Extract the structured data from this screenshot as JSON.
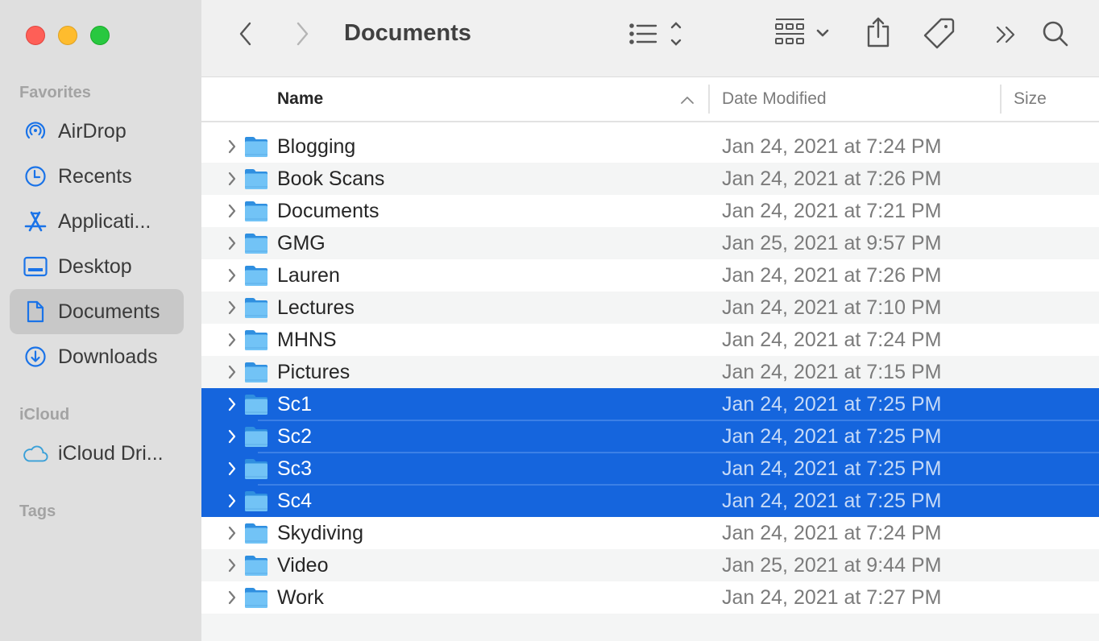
{
  "window": {
    "title": "Documents"
  },
  "sidebar": {
    "sections": [
      {
        "label": "Favorites",
        "items": [
          {
            "label": "AirDrop",
            "icon": "airdrop-icon"
          },
          {
            "label": "Recents",
            "icon": "clock-icon"
          },
          {
            "label": "Applicati...",
            "icon": "applications-icon"
          },
          {
            "label": "Desktop",
            "icon": "desktop-icon"
          },
          {
            "label": "Documents",
            "icon": "document-icon",
            "active": true
          },
          {
            "label": "Downloads",
            "icon": "download-icon"
          }
        ]
      },
      {
        "label": "iCloud",
        "items": [
          {
            "label": "iCloud Dri...",
            "icon": "cloud-icon"
          }
        ]
      },
      {
        "label": "Tags",
        "items": []
      }
    ]
  },
  "toolbar": {
    "back": "back-icon",
    "forward": "forward-icon",
    "view": "list-view-icon",
    "group": "group-grid-icon",
    "share": "share-icon",
    "tag": "tag-icon",
    "more": "more-icon",
    "search": "search-icon"
  },
  "columns": {
    "name": "Name",
    "date": "Date Modified",
    "size": "Size",
    "sort": "ascending"
  },
  "colors": {
    "selection": "#1565dd",
    "accent": "#1a73e8",
    "folder": "#6cc0f5"
  },
  "rows": [
    {
      "name": "Blogging",
      "date": "Jan 24, 2021 at 7:24 PM",
      "selected": false
    },
    {
      "name": "Book Scans",
      "date": "Jan 24, 2021 at 7:26 PM",
      "selected": false
    },
    {
      "name": "Documents",
      "date": "Jan 24, 2021 at 7:21 PM",
      "selected": false
    },
    {
      "name": "GMG",
      "date": "Jan 25, 2021 at 9:57 PM",
      "selected": false
    },
    {
      "name": "Lauren",
      "date": "Jan 24, 2021 at 7:26 PM",
      "selected": false
    },
    {
      "name": "Lectures",
      "date": "Jan 24, 2021 at 7:10 PM",
      "selected": false
    },
    {
      "name": "MHNS",
      "date": "Jan 24, 2021 at 7:24 PM",
      "selected": false
    },
    {
      "name": "Pictures",
      "date": "Jan 24, 2021 at 7:15 PM",
      "selected": false
    },
    {
      "name": "Sc1",
      "date": "Jan 24, 2021 at 7:25 PM",
      "selected": true
    },
    {
      "name": "Sc2",
      "date": "Jan 24, 2021 at 7:25 PM",
      "selected": true
    },
    {
      "name": "Sc3",
      "date": "Jan 24, 2021 at 7:25 PM",
      "selected": true
    },
    {
      "name": "Sc4",
      "date": "Jan 24, 2021 at 7:25 PM",
      "selected": true
    },
    {
      "name": "Skydiving",
      "date": "Jan 24, 2021 at 7:24 PM",
      "selected": false
    },
    {
      "name": "Video",
      "date": "Jan 25, 2021 at 9:44 PM",
      "selected": false
    },
    {
      "name": "Work",
      "date": "Jan 24, 2021 at 7:27 PM",
      "selected": false
    }
  ]
}
